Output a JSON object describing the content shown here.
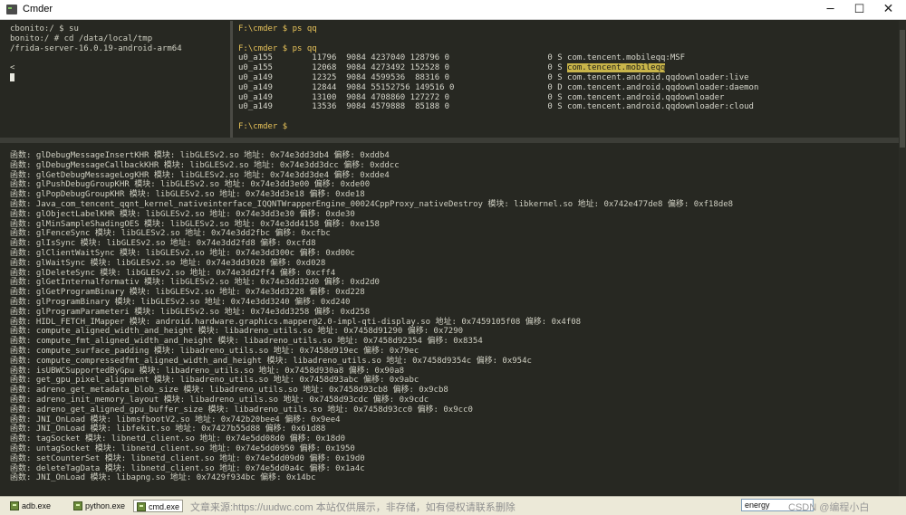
{
  "window": {
    "title": "Cmder",
    "icons": {
      "app": "cmder-icon",
      "minimize": "minimize-icon",
      "maximize": "maximize-icon",
      "close": "close-icon"
    },
    "controls": {
      "minimize": "─",
      "maximize": "☐",
      "close": "✕"
    }
  },
  "colors": {
    "terminal_bg": "#272822",
    "prompt": "#e8c35a",
    "highlight": "#c9b54a",
    "text": "#cfcfc2"
  },
  "left_pane": {
    "lines": [
      "cbonito:/ $ su",
      "bonito:/ # cd /data/local/tmp",
      "/frida-server-16.0.19-android-arm64",
      "",
      "<"
    ]
  },
  "right_pane": {
    "prompt": "F:\\cmder $",
    "command": " ps qq",
    "prompt_lines": [
      "F:\\cmder $ ps qq",
      "F:\\cmder $ ps qq",
      "F:\\cmder $"
    ],
    "rows": [
      {
        "prefix": "u0_a155        11796  9084 4237040 128796 0                    0 S ",
        "name": "com.tencent.mobileqq:MSF",
        "highlight": false
      },
      {
        "prefix": "u0_a155        12068  9084 4273492 152528 0                    0 S ",
        "name": "com.tencent.mobileqq",
        "highlight": true
      },
      {
        "prefix": "u0_a149        12325  9084 4599536  88316 0                    0 S ",
        "name": "com.tencent.android.qqdownloader:live",
        "highlight": false
      },
      {
        "prefix": "u0_a149        12844  9084 55152756 149516 0                   0 D ",
        "name": "com.tencent.android.qqdownloader:daemon",
        "highlight": false
      },
      {
        "prefix": "u0_a149        13100  9084 4708860 127272 0                    0 S ",
        "name": "com.tencent.android.qqdownloader",
        "highlight": false
      },
      {
        "prefix": "u0_a149        13536  9084 4579888  85188 0                    0 S ",
        "name": "com.tencent.android.qqdownloader:cloud",
        "highlight": false
      }
    ]
  },
  "bottom_pane": {
    "lines": [
      "函数: glDebugMessageInsertKHR 模块: libGLESv2.so 地址: 0x74e3dd3db4 偏移: 0xddb4",
      "函数: glDebugMessageCallbackKHR 模块: libGLESv2.so 地址: 0x74e3dd3dcc 偏移: 0xddcc",
      "函数: glGetDebugMessageLogKHR 模块: libGLESv2.so 地址: 0x74e3dd3de4 偏移: 0xdde4",
      "函数: glPushDebugGroupKHR 模块: libGLESv2.so 地址: 0x74e3dd3e00 偏移: 0xde00",
      "函数: glPopDebugGroupKHR 模块: libGLESv2.so 地址: 0x74e3dd3e18 偏移: 0xde18",
      "函数: Java_com_tencent_qqnt_kernel_nativeinterface_IQQNTWrapperEngine_00024CppProxy_nativeDestroy 模块: libkernel.so 地址: 0x742e477de8 偏移: 0xf18de8",
      "函数: glObjectLabelKHR 模块: libGLESv2.so 地址: 0x74e3dd3e30 偏移: 0xde30",
      "函数: glMinSampleShadingOES 模块: libGLESv2.so 地址: 0x74e3dd4158 偏移: 0xe158",
      "函数: glFenceSync 模块: libGLESv2.so 地址: 0x74e3dd2fbc 偏移: 0xcfbc",
      "函数: glIsSync 模块: libGLESv2.so 地址: 0x74e3dd2fd8 偏移: 0xcfd8",
      "函数: glClientWaitSync 模块: libGLESv2.so 地址: 0x74e3dd300c 偏移: 0xd00c",
      "函数: glWaitSync 模块: libGLESv2.so 地址: 0x74e3dd3028 偏移: 0xd028",
      "函数: glDeleteSync 模块: libGLESv2.so 地址: 0x74e3dd2ff4 偏移: 0xcff4",
      "函数: glGetInternalformativ 模块: libGLESv2.so 地址: 0x74e3dd32d0 偏移: 0xd2d0",
      "函数: glGetProgramBinary 模块: libGLESv2.so 地址: 0x74e3dd3228 偏移: 0xd228",
      "函数: glProgramBinary 模块: libGLESv2.so 地址: 0x74e3dd3240 偏移: 0xd240",
      "函数: glProgramParameteri 模块: libGLESv2.so 地址: 0x74e3dd3258 偏移: 0xd258",
      "函数: HIDL_FETCH_IMapper 模块: android.hardware.graphics.mapper@2.0-impl-qti-display.so 地址: 0x7459105f08 偏移: 0x4f08",
      "函数: compute_aligned_width_and_height 模块: libadreno_utils.so 地址: 0x7458d91290 偏移: 0x7290",
      "函数: compute_fmt_aligned_width_and_height 模块: libadreno_utils.so 地址: 0x7458d92354 偏移: 0x8354",
      "函数: compute_surface_padding 模块: libadreno_utils.so 地址: 0x7458d919ec 偏移: 0x79ec",
      "函数: compute_compressedfmt_aligned_width_and_height 模块: libadreno_utils.so 地址: 0x7458d9354c 偏移: 0x954c",
      "函数: isUBWCSupportedByGpu 模块: libadreno_utils.so 地址: 0x7458d930a8 偏移: 0x90a8",
      "函数: get_gpu_pixel_alignment 模块: libadreno_utils.so 地址: 0x7458d93abc 偏移: 0x9abc",
      "函数: adreno_get_metadata_blob_size 模块: libadreno_utils.so 地址: 0x7458d93cb8 偏移: 0x9cb8",
      "函数: adreno_init_memory_layout 模块: libadreno_utils.so 地址: 0x7458d93cdc 偏移: 0x9cdc",
      "函数: adreno_get_aligned_gpu_buffer_size 模块: libadreno_utils.so 地址: 0x7458d93cc0 偏移: 0x9cc0",
      "函数: JNI_OnLoad 模块: libmsfbootV2.so 地址: 0x742b20bee4 偏移: 0x9ee4",
      "函数: JNI_OnLoad 模块: libfekit.so 地址: 0x7427b55d88 偏移: 0x61d88",
      "函数: tagSocket 模块: libnetd_client.so 地址: 0x74e5dd08d0 偏移: 0x18d0",
      "函数: untagSocket 模块: libnetd_client.so 地址: 0x74e5dd0950 偏移: 0x1950",
      "函数: setCounterSet 模块: libnetd_client.so 地址: 0x74e5dd09d0 偏移: 0x19d0",
      "函数: deleteTagData 模块: libnetd_client.so 地址: 0x74e5dd0a4c 偏移: 0x1a4c",
      "函数: JNI_OnLoad 模块: libapng.so 地址: 0x7429f934bc 偏移: 0x14bc"
    ]
  },
  "statusbar": {
    "tabs": [
      {
        "label": "adb.exe",
        "icon": "console-icon",
        "active": false
      },
      {
        "label": "python.exe",
        "icon": "console-icon",
        "active": false
      },
      {
        "label": "cmd.exe",
        "icon": "console-icon",
        "active": true
      }
    ],
    "watermark": "文章来源:https://uudwc.com 本站仅供展示，非存储，如有侵权请联系删除",
    "search_value": "energy",
    "right_text": "CSDN @编程小白"
  }
}
